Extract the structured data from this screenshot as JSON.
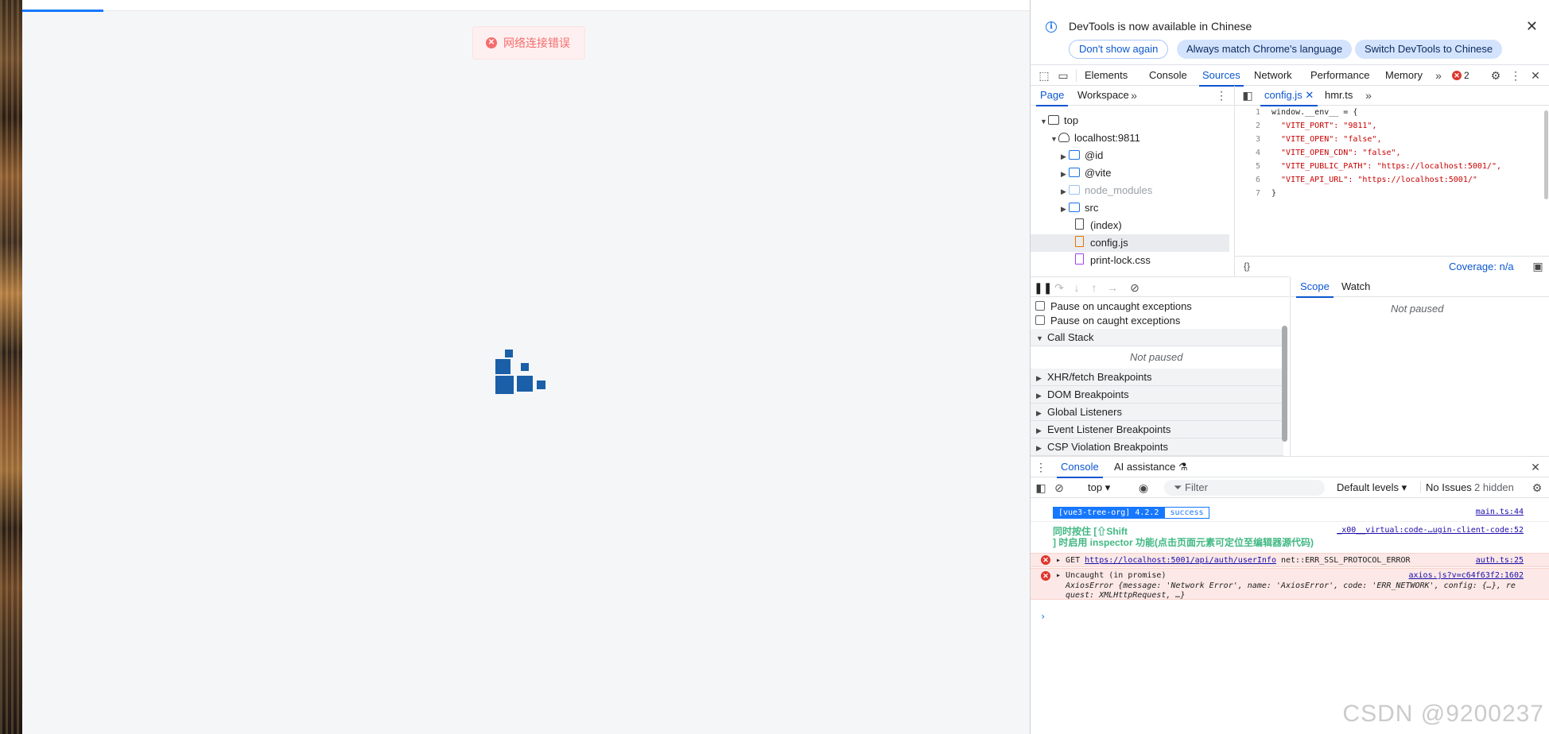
{
  "app": {
    "toast": {
      "message": "网络连接错误",
      "color": "#f56c6c"
    },
    "loader": {
      "color": "#1a5fa8"
    }
  },
  "devtools": {
    "infobar": {
      "message": "DevTools is now available in Chinese",
      "buttons": [
        "Don't show again",
        "Always match Chrome's language",
        "Switch DevTools to Chinese"
      ]
    },
    "main_tabs": [
      "Elements",
      "Console",
      "Sources",
      "Network",
      "Performance",
      "Memory"
    ],
    "active_tab": "Sources",
    "error_count": "2",
    "sources": {
      "nav_tabs": [
        "Page",
        "Workspace"
      ],
      "file_tabs": [
        "config.js",
        "hmr.ts"
      ],
      "tree": [
        {
          "label": "top",
          "type": "frame"
        },
        {
          "label": "localhost:9811",
          "type": "origin"
        },
        {
          "label": "@id",
          "type": "folder"
        },
        {
          "label": "@vite",
          "type": "folder"
        },
        {
          "label": "node_modules",
          "type": "folder"
        },
        {
          "label": "src",
          "type": "folder"
        },
        {
          "label": "(index)",
          "type": "file"
        },
        {
          "label": "config.js",
          "type": "file-js"
        },
        {
          "label": "print-lock.css",
          "type": "file-css"
        }
      ],
      "code": [
        {
          "n": "1",
          "text": "window.__env__ = {"
        },
        {
          "n": "2",
          "text": "  \"VITE_PORT\": \"9811\","
        },
        {
          "n": "3",
          "text": "  \"VITE_OPEN\": \"false\","
        },
        {
          "n": "4",
          "text": "  \"VITE_OPEN_CDN\": \"false\","
        },
        {
          "n": "5",
          "text": "  \"VITE_PUBLIC_PATH\": \"https://localhost:5001/\","
        },
        {
          "n": "6",
          "text": "  \"VITE_API_URL\": \"https://localhost:5001/\""
        },
        {
          "n": "7",
          "text": "}"
        }
      ],
      "coverage": "Coverage: n/a"
    },
    "debugger": {
      "checkboxes": [
        "Pause on uncaught exceptions",
        "Pause on caught exceptions"
      ],
      "call_stack": "Call Stack",
      "not_paused": "Not paused",
      "sections": [
        "XHR/fetch Breakpoints",
        "DOM Breakpoints",
        "Global Listeners",
        "Event Listener Breakpoints",
        "CSP Violation Breakpoints"
      ],
      "right_tabs": [
        "Scope",
        "Watch"
      ]
    },
    "drawer": {
      "tabs": [
        "Console",
        "AI assistance"
      ],
      "context": "top",
      "filter_placeholder": "Filter",
      "levels": "Default levels",
      "issues": "No Issues",
      "hidden": "2 hidden"
    },
    "console": {
      "row1": {
        "badge_a": "[vue3-tree-org] 4.2.2",
        "badge_b": "success",
        "source": "main.ts:44"
      },
      "row2": {
        "line1": "同时按住 [⇧Shift",
        "line2": "] 时启用 inspector 功能(点击页面元素可定位至编辑器源代码)",
        "source": "_x00__virtual:code-…ugin-client-code:52"
      },
      "row3": {
        "prefix": "GET",
        "url": "https://localhost:5001/api/auth/userInfo",
        "error": "net::ERR_SSL_PROTOCOL_ERROR",
        "source": "auth.ts:25"
      },
      "row4": {
        "head": "Uncaught (in promise)",
        "source": "axios.js?v=c64f63f2:1602",
        "detail1": "AxiosError  {message: 'Network Error', name: 'AxiosError', code: 'ERR_NETWORK', config: {…}, re",
        "detail2": "quest: XMLHttpRequest, …}"
      }
    }
  },
  "watermark": "CSDN @9200237"
}
